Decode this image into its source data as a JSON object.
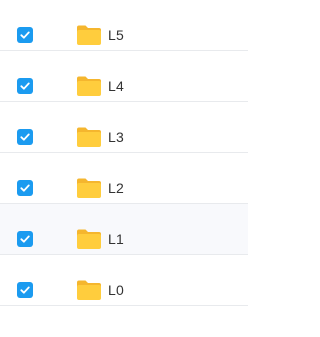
{
  "colors": {
    "checkbox": "#1b9bf0",
    "folder_body": "#ffcd3d",
    "folder_tab": "#f5b62e",
    "text": "#333333",
    "divider": "#e8eaed",
    "row_highlight": "#f8f9fc"
  },
  "rows": [
    {
      "name": "L5",
      "checked": true,
      "icon": "folder-icon"
    },
    {
      "name": "L4",
      "checked": true,
      "icon": "folder-icon"
    },
    {
      "name": "L3",
      "checked": true,
      "icon": "folder-icon"
    },
    {
      "name": "L2",
      "checked": true,
      "icon": "folder-icon"
    },
    {
      "name": "L1",
      "checked": true,
      "icon": "folder-icon",
      "highlighted": true
    },
    {
      "name": "L0",
      "checked": true,
      "icon": "folder-icon"
    }
  ]
}
